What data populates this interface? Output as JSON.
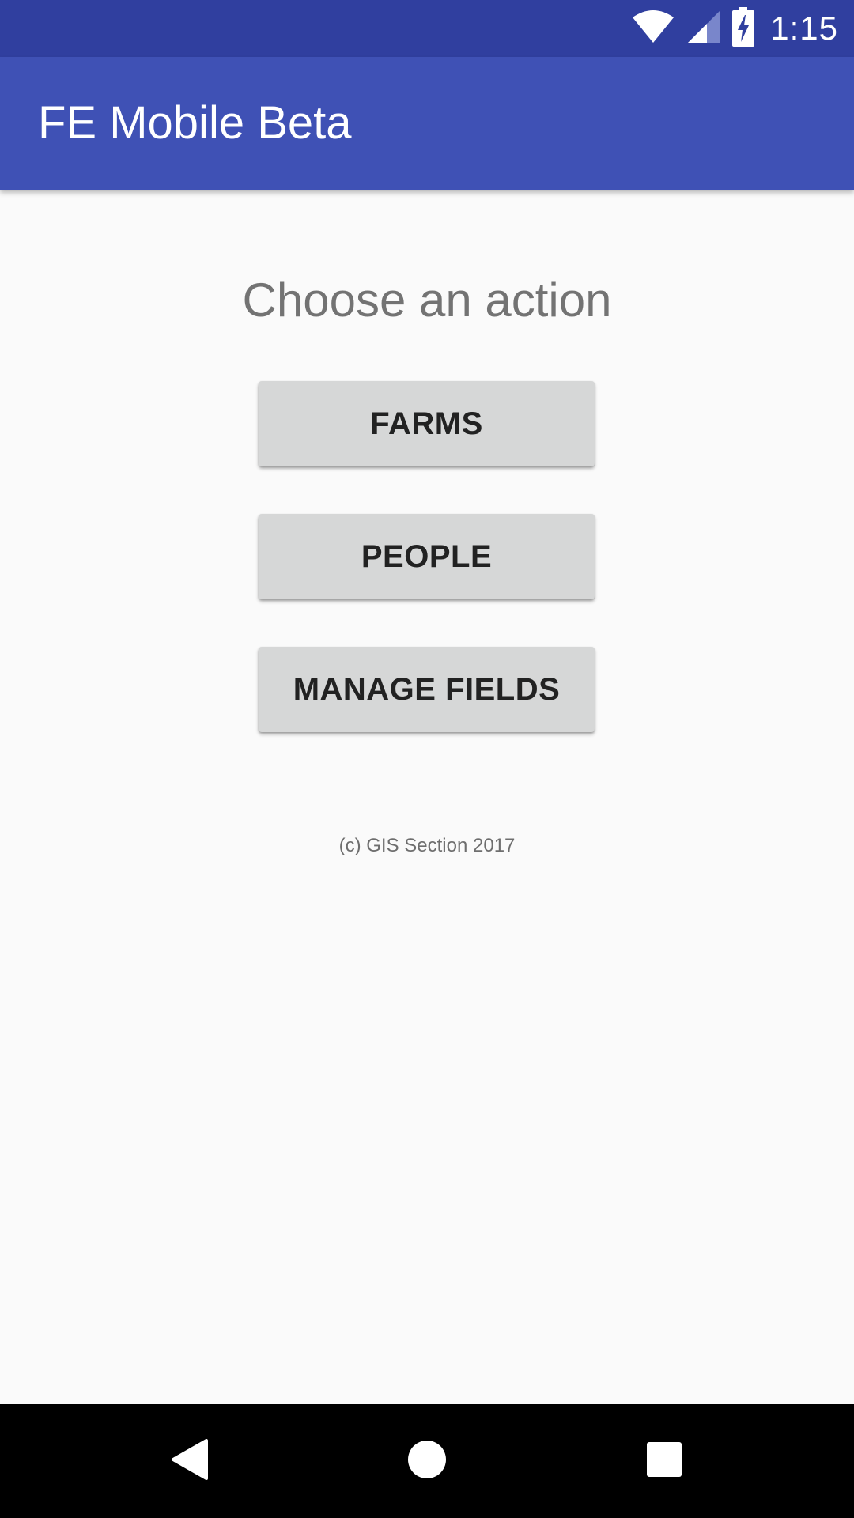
{
  "status_bar": {
    "time": "1:15",
    "icons": [
      "wifi-icon",
      "cell-signal-icon",
      "battery-charging-icon"
    ]
  },
  "app_bar": {
    "title": "FE Mobile Beta"
  },
  "main": {
    "heading": "Choose an action",
    "buttons": [
      {
        "label": "FARMS"
      },
      {
        "label": "PEOPLE"
      },
      {
        "label": "MANAGE FIELDS"
      }
    ],
    "footer": "(c) GIS Section 2017"
  },
  "nav_bar": {
    "icons": [
      "back-icon",
      "home-icon",
      "recents-icon"
    ]
  },
  "colors": {
    "status_bar": "#303f9f",
    "app_bar": "#3f51b5",
    "background": "#fafafa",
    "button": "#d6d7d7",
    "nav_bar": "#000000"
  }
}
